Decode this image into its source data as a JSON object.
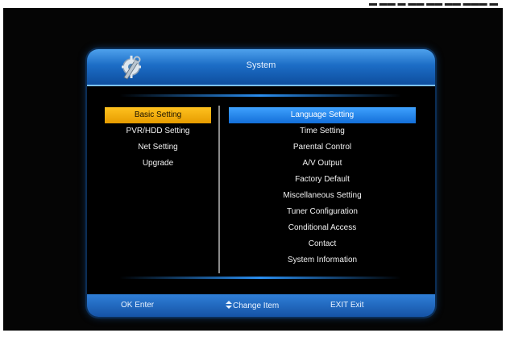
{
  "window": {
    "title": "System"
  },
  "left_menu": {
    "items": [
      {
        "label": "Basic Setting",
        "selected": true
      },
      {
        "label": "PVR/HDD Setting",
        "selected": false
      },
      {
        "label": "Net Setting",
        "selected": false
      },
      {
        "label": "Upgrade",
        "selected": false
      }
    ]
  },
  "right_menu": {
    "items": [
      {
        "label": "Language Setting",
        "selected": true
      },
      {
        "label": "Time Setting",
        "selected": false
      },
      {
        "label": "Parental Control",
        "selected": false
      },
      {
        "label": "A/V Output",
        "selected": false
      },
      {
        "label": "Factory Default",
        "selected": false
      },
      {
        "label": "Miscellaneous Setting",
        "selected": false
      },
      {
        "label": "Tuner Configuration",
        "selected": false
      },
      {
        "label": "Conditional Access",
        "selected": false
      },
      {
        "label": "Contact",
        "selected": false
      },
      {
        "label": "System Information",
        "selected": false
      }
    ]
  },
  "footer": {
    "ok_label": "OK Enter",
    "change_label": "Change Item",
    "exit_label": "EXIT Exit"
  },
  "colors": {
    "accent_blue": "#1c6dc6",
    "highlight_yellow": "#ffc21f",
    "highlight_blue": "#3fa2ff",
    "background": "#050505"
  },
  "icons": {
    "logo": "gear-wrench-icon",
    "updown": "up-down-arrow-icon"
  }
}
